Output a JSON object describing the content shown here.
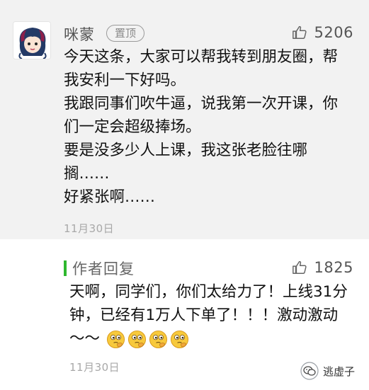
{
  "comment": {
    "username": "咪蒙",
    "pin_label": "置顶",
    "like_count": "5206",
    "lines": [
      "今天这条，大家可以帮我转到朋友圈，帮",
      "我安利一下好吗。",
      "我跟同事们吹牛逼，说我第一次开课，你",
      "们一定会超级捧场。",
      "要是没多少人上课，我这张老脸往哪",
      "搁……",
      "好紧张啊……"
    ],
    "date": "11月30日"
  },
  "reply": {
    "label": "作者回复",
    "like_count": "1825",
    "lines": [
      "天啊，同学们，你们太给力了！上线31分",
      "钟，已经有1万人下单了！！！激动激动",
      "～～"
    ],
    "emoji_count": 4,
    "emoji_name": "thinking-emoji",
    "date": "11月30日"
  },
  "watermark": {
    "text": "逃虚子",
    "icon": "wechat-official-icon"
  },
  "colors": {
    "reply_bar": "#2eb82e",
    "comment_bg": "#f2f2f2",
    "reply_bg": "#ffffff"
  }
}
